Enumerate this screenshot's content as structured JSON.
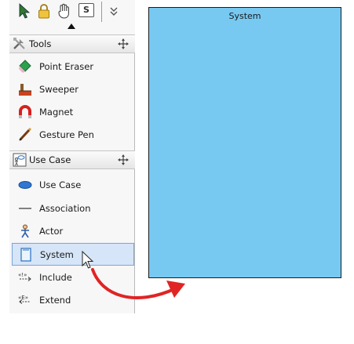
{
  "system_shape": {
    "title": "System",
    "fill": "#77c9f1"
  },
  "toolbar": {
    "tools": [
      {
        "icon": "selector-arrow-icon"
      },
      {
        "icon": "lock-icon"
      },
      {
        "icon": "hand-pan-icon"
      },
      {
        "icon": "sticky-mode-icon",
        "label": "S"
      },
      {
        "icon": "more-chevron-icon"
      }
    ]
  },
  "groups": [
    {
      "label": "Tools",
      "icon": "tools-group-icon",
      "items": [
        {
          "label": "Point Eraser",
          "icon": "point-eraser-icon"
        },
        {
          "label": "Sweeper",
          "icon": "sweeper-icon"
        },
        {
          "label": "Magnet",
          "icon": "magnet-icon"
        },
        {
          "label": "Gesture Pen",
          "icon": "gesture-pen-icon"
        }
      ]
    },
    {
      "label": "Use Case",
      "icon": "use-case-group-icon",
      "items": [
        {
          "label": "Use Case",
          "icon": "use-case-ellipse-icon"
        },
        {
          "label": "Association",
          "icon": "association-line-icon"
        },
        {
          "label": "Actor",
          "icon": "actor-icon"
        },
        {
          "label": "System",
          "icon": "system-boundary-icon",
          "selected": true
        },
        {
          "label": "Include",
          "icon": "include-icon"
        },
        {
          "label": "Extend",
          "icon": "extend-icon"
        }
      ]
    }
  ],
  "colors": {
    "selection_bg": "#d6e5f7",
    "drag_arrow": "#e02424"
  }
}
